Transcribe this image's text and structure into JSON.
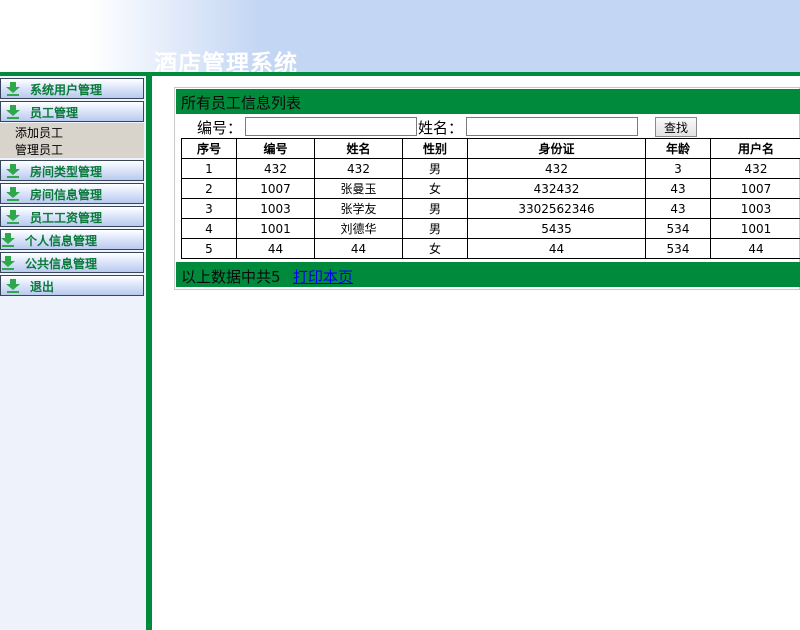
{
  "header": {
    "title": "酒店管理系统"
  },
  "sidebar": {
    "items": [
      {
        "label": "系统用户管理"
      },
      {
        "label": "员工管理"
      },
      {
        "label": "房间类型管理"
      },
      {
        "label": "房间信息管理"
      },
      {
        "label": "员工工资管理"
      },
      {
        "label": "个人信息管理"
      },
      {
        "label": "公共信息管理"
      },
      {
        "label": "退出"
      }
    ],
    "submenu": [
      {
        "label": "添加员工"
      },
      {
        "label": "管理员工"
      }
    ]
  },
  "main": {
    "title": "所有员工信息列表",
    "search": {
      "id_label": "编号：",
      "id_value": "",
      "name_label": "姓名：",
      "name_value": "",
      "button_label": "查找"
    },
    "table": {
      "columns": [
        "序号",
        "编号",
        "姓名",
        "性别",
        "身份证",
        "年龄",
        "用户名"
      ],
      "rows": [
        [
          "1",
          "432",
          "432",
          "男",
          "432",
          "3",
          "432"
        ],
        [
          "2",
          "1007",
          "张曼玉",
          "女",
          "432432",
          "43",
          "1007"
        ],
        [
          "3",
          "1003",
          "张学友",
          "男",
          "3302562346",
          "43",
          "1003"
        ],
        [
          "4",
          "1001",
          "刘德华",
          "男",
          "5435",
          "534",
          "1001"
        ],
        [
          "5",
          "44",
          "44",
          "女",
          "44",
          "534",
          "44"
        ]
      ]
    },
    "footer": {
      "summary": "以上数据中共5",
      "print_link": "打印本页"
    }
  },
  "colors": {
    "accent_green": "#008a3c",
    "header_blue": "#c3d6f4",
    "menu_text": "#0a7a3a",
    "sidebar_bg": "#eef2fa"
  },
  "icons": {
    "menu_icon": "green-down-arrow-icon"
  }
}
